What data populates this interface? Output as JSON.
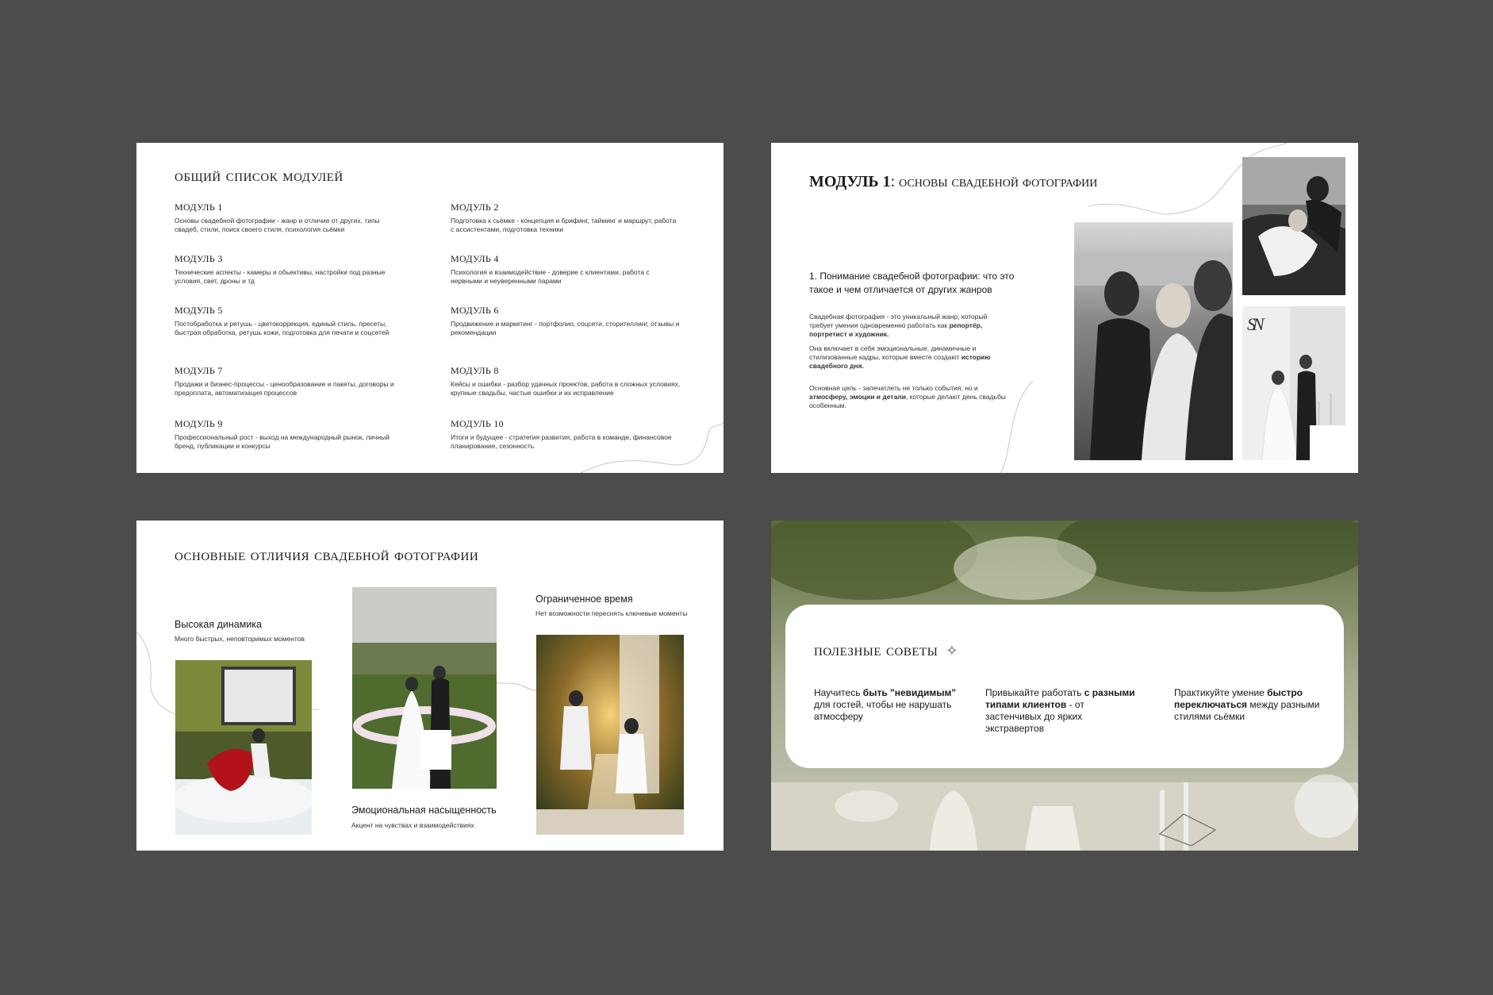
{
  "slide1": {
    "title": "ОБЩИЙ СПИСОК МОДУЛЕЙ",
    "modules": [
      {
        "name": "МОДУЛЬ 1",
        "desc": "Основы свадебной фотографии - жанр и отличие от других, типы свадеб, стили, поиск своего стиля, психология сьёмки"
      },
      {
        "name": "МОДУЛЬ 2",
        "desc": "Подготовка к сьёмке - концепция и брифинг, тайминг и маршрут, работа с ассистентами, подготовка техники"
      },
      {
        "name": "МОДУЛЬ 3",
        "desc": "Технические аспекты - камеры и обьективы, настройки под разные условия, свет, дроны и тд"
      },
      {
        "name": "МОДУЛЬ 4",
        "desc": "Психология и взаимодействие - доверие с клиентами, работа с нервными и неуверенными парами"
      },
      {
        "name": "МОДУЛЬ 5",
        "desc": "Постобработка и ретушь - цветокоррекция, единый стиль, пресеты, быстрая обработка, ретушь кожи, подготовка для печати и соцсетей"
      },
      {
        "name": "МОДУЛЬ 6",
        "desc": "Продвижение и маркетинг - портфолио, соцсети, сторителлинг, отзывы и рекомендации"
      },
      {
        "name": "МОДУЛЬ 7",
        "desc": "Продажи и бизнес-процессы - ценообразование и пакеты, договоры и предоплата, автоматизация процессов"
      },
      {
        "name": "МОДУЛЬ 8",
        "desc": "Кейсы и ошибки - разбор удачных проектов, работа в сложных условиях, крупные свадьбы, частые ошибки и их исправление"
      },
      {
        "name": "МОДУЛЬ 9",
        "desc": "Профессиональный рост - выход на международный рынок, личный бренд, публикации и конкурсы"
      },
      {
        "name": "МОДУЛЬ 10",
        "desc": "Итоги и будущее - стратегия развития, работа в команде, финансовое планирование, сезонность"
      }
    ]
  },
  "slide2": {
    "title_bold": "МОДУЛЬ 1",
    "title_rest": ": ОСНОВЫ СВАДЕБНОЙ ФОТОГРАФИИ",
    "subtitle": "1. Понимание свадебной фотографии: что это такое и чем отличается от других жанров",
    "p1": "Свадебная фотография - это уникальный жанр, который требует умения одновременно работать как ",
    "p1_bold": "репортёр, портретист и художник.",
    "p2": "Она включает в себя эмоциональные, динамичные и стилизованные кадры, которые вместе создают ",
    "p2_bold": "историю свадебного дня.",
    "p3": "Основная цель - запечатлеть не только события, но и ",
    "p3_bold": "атмосферу, эмоции и детали",
    "p3_end": ", которые делают день свадьбы особенным.",
    "monogram": "SN"
  },
  "slide3": {
    "title": "ОСНОВНЫЕ ОТЛИЧИЯ СВАДЕБНОЙ ФОТОГРАФИИ",
    "features": [
      {
        "title": "Высокая динамика",
        "desc": "Много быстрых, неповторимых моментов"
      },
      {
        "title": "Эмоциональная насыщенность",
        "desc": "Акцент на чувствах и взаимодействиях"
      },
      {
        "title": "Ограниченное время",
        "desc": "Нет возможности переснять ключевые моменты"
      }
    ]
  },
  "slide4": {
    "title": "полезные советы",
    "tips": [
      {
        "pre": "Научитесь ",
        "bold": "быть \"невидимым\"",
        "post": " для гостей, чтобы не нарушать атмосферу"
      },
      {
        "pre": "Привыкайте работать ",
        "bold": "с разными типами клиентов",
        "post": " - от застенчивых до ярких экстравертов"
      },
      {
        "pre": "Практикуйте умение ",
        "bold": "быстро переключаться",
        "post": " между разными стилями сьёмки"
      }
    ]
  },
  "colors": {
    "background": "#4c4c4c",
    "slide": "#ffffff",
    "text": "#1a1a1a"
  }
}
